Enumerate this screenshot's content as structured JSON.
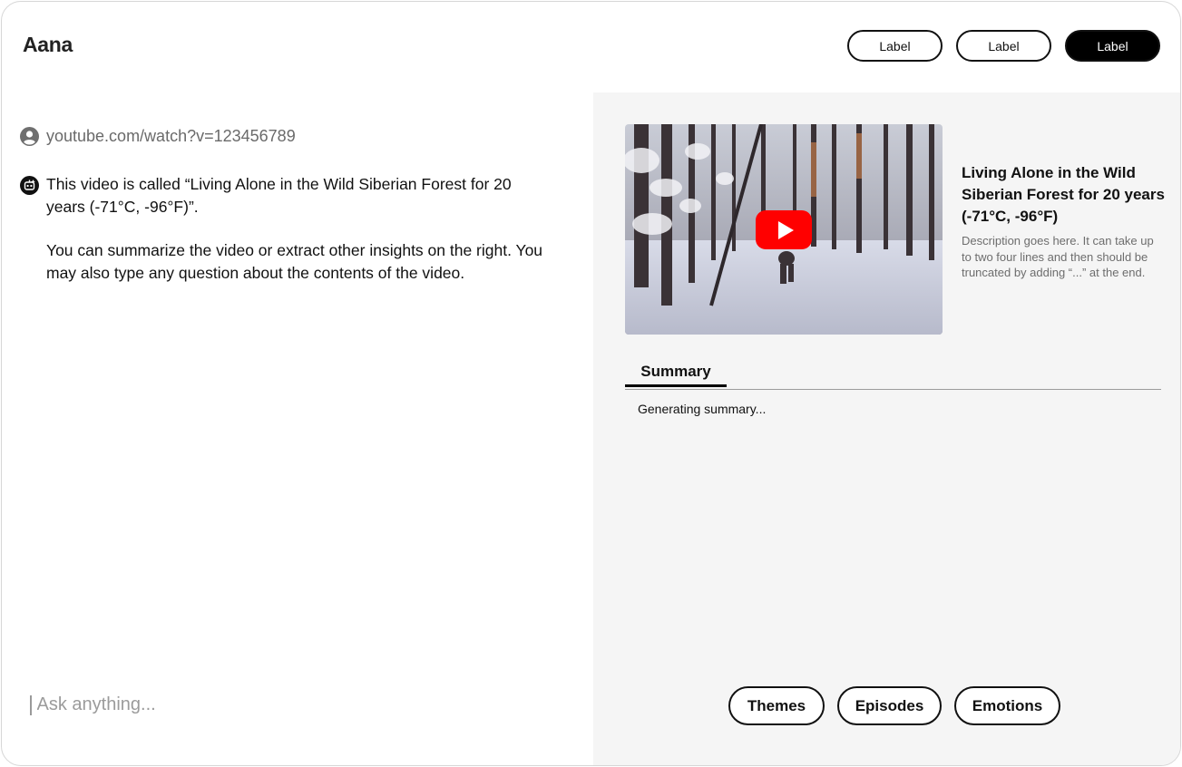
{
  "app": {
    "title": "Aana"
  },
  "header_actions": [
    {
      "label": "Label",
      "style": "outline"
    },
    {
      "label": "Label",
      "style": "outline"
    },
    {
      "label": "Label",
      "style": "filled"
    }
  ],
  "chat": {
    "url_message": {
      "text": "youtube.com/watch?v=123456789",
      "avatar_icon": "user-avatar-icon"
    },
    "bot_message": {
      "avatar_icon": "bot-avatar-icon",
      "paragraphs": [
        "This video is called “Living Alone in the Wild Siberian Forest for 20 years (-71°C, -96°F)”.",
        "You can summarize the video or extract other insights on the right. You may also type any question about the contents of the video."
      ]
    },
    "input": {
      "placeholder": "Ask anything...",
      "value": ""
    }
  },
  "video": {
    "title": "Living Alone in the Wild Siberian Forest for 20 years (-71°C, -96°F)",
    "description": "Description goes here. It can take up to two four lines and then should be truncated by adding “...” at the end.",
    "play_icon": "youtube-play-icon"
  },
  "tabs": [
    {
      "label": "Summary",
      "active": true
    }
  ],
  "summary": {
    "status": "Generating summary..."
  },
  "insight_chips": [
    "Themes",
    "Episodes",
    "Emotions"
  ],
  "colors": {
    "panel_bg": "#f5f5f5",
    "youtube_red": "#ff0000",
    "primary": "#000000"
  }
}
